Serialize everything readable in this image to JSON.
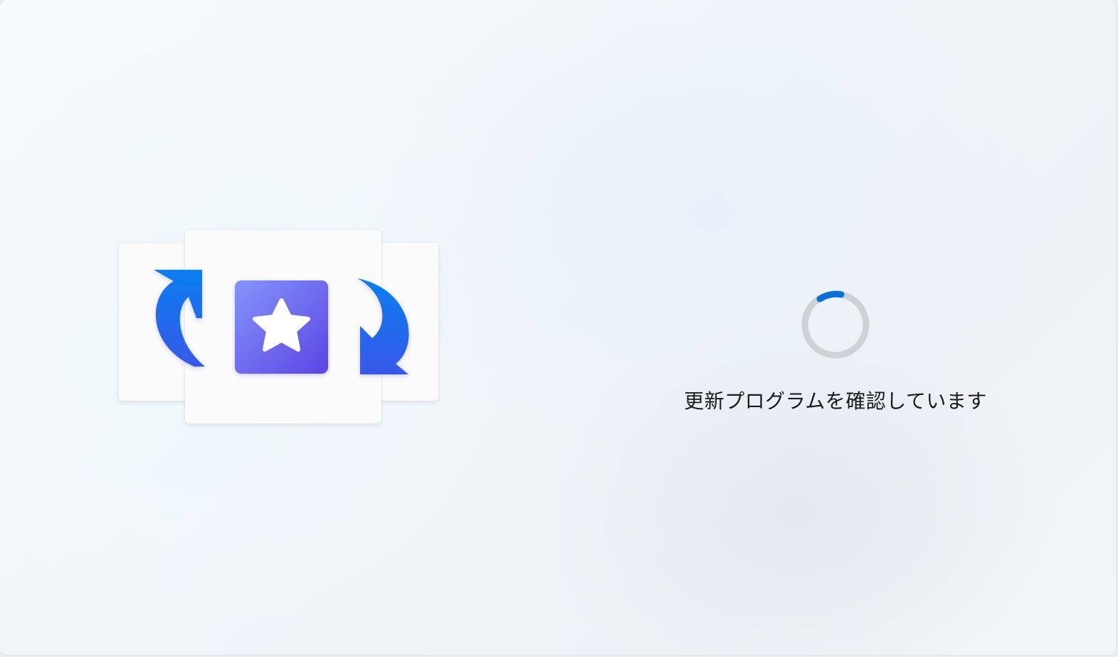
{
  "status": {
    "message": "更新プログラムを確認しています"
  },
  "spinner": {
    "track_color": "#cfd1d4",
    "arc_color": "#0a6fd8"
  },
  "illustration": {
    "icons": [
      "refresh-arrow-left-icon",
      "star-app-icon",
      "refresh-arrow-right-icon"
    ],
    "arrow_gradient": [
      "#0a7ef0",
      "#3858e8"
    ],
    "tile_gradient": [
      "#7c8cf8",
      "#5d4ae6"
    ]
  }
}
